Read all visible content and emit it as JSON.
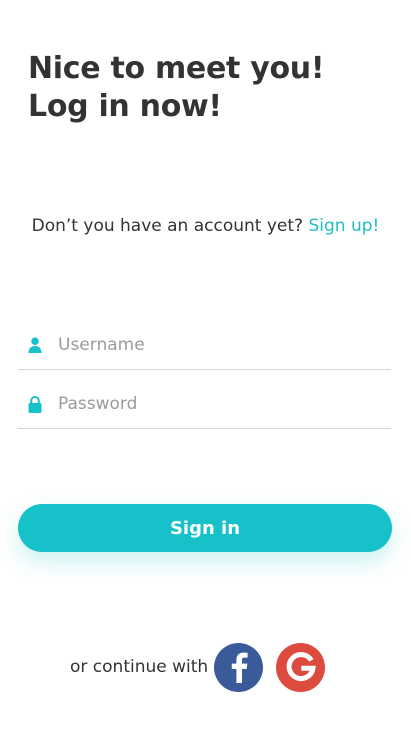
{
  "heading": {
    "line1": "Nice to meet you!",
    "line2": "Log in now!"
  },
  "signup": {
    "prompt": "Don’t you have an account yet?",
    "link": "Sign up!"
  },
  "form": {
    "username_placeholder": "Username",
    "password_placeholder": "Password"
  },
  "signin_button": "Sign in",
  "social": {
    "label": "or continue with",
    "providers": [
      "facebook",
      "google"
    ]
  },
  "icons": {
    "username": "user-icon",
    "password": "lock-icon",
    "facebook": "facebook-icon",
    "google": "google-icon"
  },
  "colors": {
    "accent": "#17c1c9",
    "link": "#1ebfc8",
    "facebook": "#3b5a9a",
    "google": "#dd4b3e",
    "text": "#333333"
  }
}
